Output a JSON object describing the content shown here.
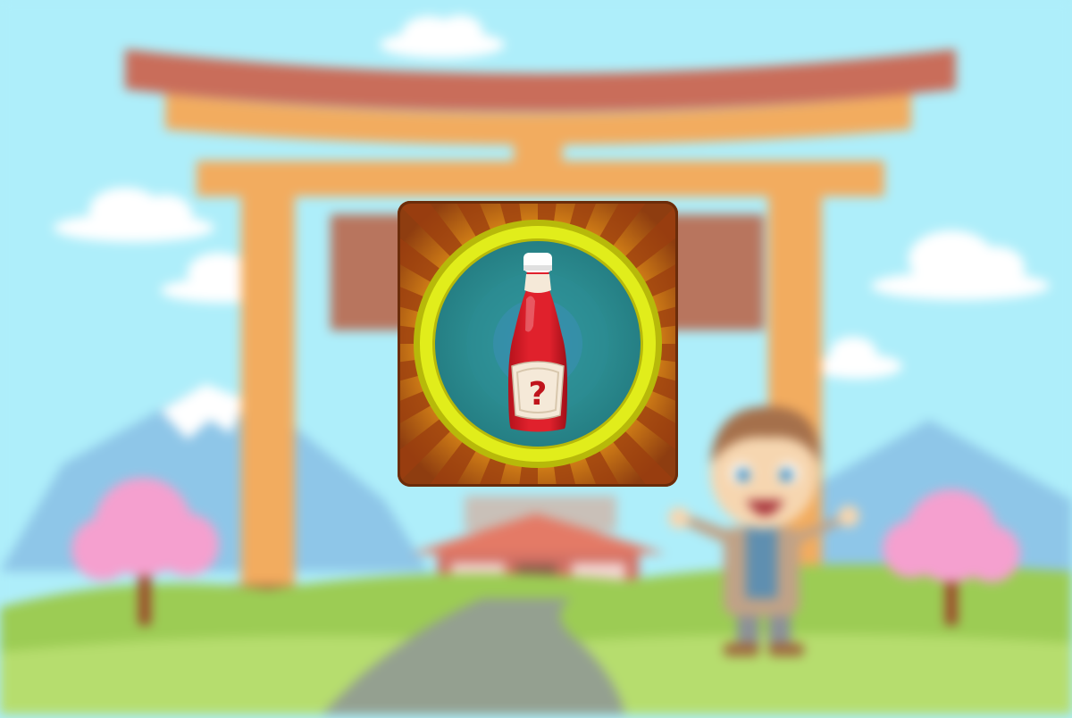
{
  "scene": {
    "name": "torii-gate-meadow",
    "colors": {
      "sky": "#aeeefa",
      "cloud": "#ffffff",
      "gate_pillar": "#f2ac5f",
      "gate_top_beam": "#c96d5a",
      "mountain": "#8ec6e8",
      "snow_cap": "#ffffff",
      "grass": "#9ccc54",
      "path": "#94a090",
      "blossom": "#f5a0cf",
      "temple_roof": "#e47a66"
    },
    "character": {
      "name": "smiling-boy",
      "hair_color": "#a5704b",
      "jacket_color": "#c0a287",
      "shirt_color": "#5f8fb0"
    }
  },
  "reward": {
    "item_icon": "ketchup-bottle-icon",
    "mystery_symbol": "?",
    "colors": {
      "card_bg": "#8e3d10",
      "ray_light": "#ffcc29",
      "ray_dark": "#9b3e0f",
      "coin_rim": "#e1ed1b",
      "coin_rim_edge": "#b7b90a",
      "coin_face": "#2f9397",
      "coin_center": "#3c8fb8",
      "bottle_red": "#e0212c",
      "bottle_cap": "#fefefe",
      "label_cream": "#f5e9d8",
      "symbol_red": "#c0141c"
    }
  }
}
